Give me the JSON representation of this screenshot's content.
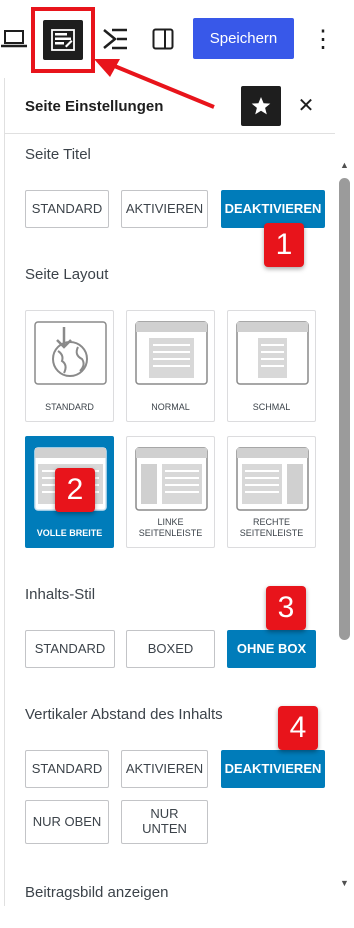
{
  "toolbar": {
    "icons": [
      "laptop-icon",
      "page-settings-icon",
      "list-view-icon",
      "sidebar-toggle-icon",
      "more-vertical-icon"
    ],
    "save_label": "Speichern",
    "more_glyph": "⋮"
  },
  "panel": {
    "title": "Seite Einstellungen",
    "close_glyph": "✕"
  },
  "seite_titel": {
    "label": "Seite Titel",
    "options": [
      "STANDARD",
      "AKTIVIEREN",
      "DEAKTIVIEREN"
    ],
    "selected": "DEAKTIVIEREN"
  },
  "seite_layout": {
    "label": "Seite Layout",
    "options": [
      {
        "label": "STANDARD",
        "icon": "globe-download-icon"
      },
      {
        "label": "NORMAL",
        "icon": "layout-normal-icon"
      },
      {
        "label": "SCHMAL",
        "icon": "layout-narrow-icon"
      },
      {
        "label": "VOLLE BREITE",
        "icon": "layout-full-width-icon"
      },
      {
        "label": "LINKE SEITENLEISTE",
        "icon": "layout-left-sidebar-icon"
      },
      {
        "label": "RECHTE SEITENLEISTE",
        "icon": "layout-right-sidebar-icon"
      }
    ],
    "selected": "VOLLE BREITE"
  },
  "inhalts_stil": {
    "label": "Inhalts-Stil",
    "options": [
      "STANDARD",
      "BOXED",
      "OHNE BOX"
    ],
    "selected": "OHNE BOX"
  },
  "vertikaler_abstand": {
    "label": "Vertikaler Abstand des Inhalts",
    "options": [
      "STANDARD",
      "AKTIVIEREN",
      "DEAKTIVIEREN",
      "NUR OBEN",
      "NUR UNTEN"
    ],
    "selected": "DEAKTIVIEREN"
  },
  "beitragsbild": {
    "label": "Beitragsbild anzeigen"
  },
  "annotations": {
    "badges": [
      "1",
      "2",
      "3",
      "4"
    ],
    "colors": {
      "annotation": "#e8141b",
      "accent": "#007cba",
      "save": "#3858e9"
    }
  }
}
